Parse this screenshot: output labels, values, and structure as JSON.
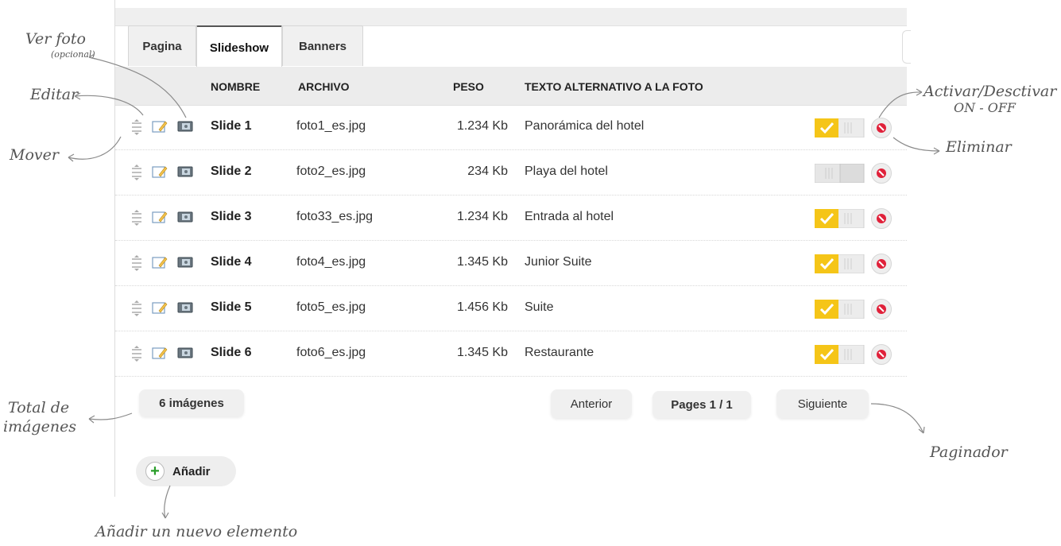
{
  "tabs": [
    {
      "label": "Pagina",
      "active": false
    },
    {
      "label": "Slideshow",
      "active": true
    },
    {
      "label": "Banners",
      "active": false
    }
  ],
  "table": {
    "columns": [
      "NOMBRE",
      "ARCHIVO",
      "PESO",
      "TEXTO ALTERNATIVO A LA FOTO"
    ],
    "rows": [
      {
        "name": "Slide 1",
        "file": "foto1_es.jpg",
        "size": "1.234 Kb",
        "alt": "Panorámica del hotel",
        "active": true
      },
      {
        "name": "Slide 2",
        "file": "foto2_es.jpg",
        "size": "234 Kb",
        "alt": "Playa del hotel",
        "active": false
      },
      {
        "name": "Slide 3",
        "file": "foto33_es.jpg",
        "size": "1.234 Kb",
        "alt": "Entrada al hotel",
        "active": true
      },
      {
        "name": "Slide 4",
        "file": "foto4_es.jpg",
        "size": "1.345 Kb",
        "alt": "Junior Suite",
        "active": true
      },
      {
        "name": "Slide 5",
        "file": "foto5_es.jpg",
        "size": "1.456 Kb",
        "alt": "Suite",
        "active": true
      },
      {
        "name": "Slide 6",
        "file": "foto6_es.jpg",
        "size": "1.345 Kb",
        "alt": "Restaurante",
        "active": true
      }
    ]
  },
  "footer": {
    "total": "6 imágenes",
    "prev": "Anterior",
    "pages": "Pages 1 / 1",
    "next": "Siguiente",
    "add": "Añadir"
  },
  "annotations": {
    "ver_foto": "Ver foto",
    "ver_foto_sub": "(opcional)",
    "editar": "Editar",
    "mover": "Mover",
    "activar_1": "Activar/Desctivar",
    "activar_2": "ON - OFF",
    "eliminar": "Eliminar",
    "total_1": "Total de",
    "total_2": "imágenes",
    "paginador": "Paginador",
    "anadir": "Añadir un nuevo elemento"
  },
  "colors": {
    "toggle_on": "#f5c518",
    "delete": "#e0213a",
    "add_plus": "#2a9d2a"
  },
  "icons": [
    "move-icon",
    "edit-icon",
    "photo-icon",
    "check-icon",
    "delete-icon",
    "plus-icon"
  ]
}
